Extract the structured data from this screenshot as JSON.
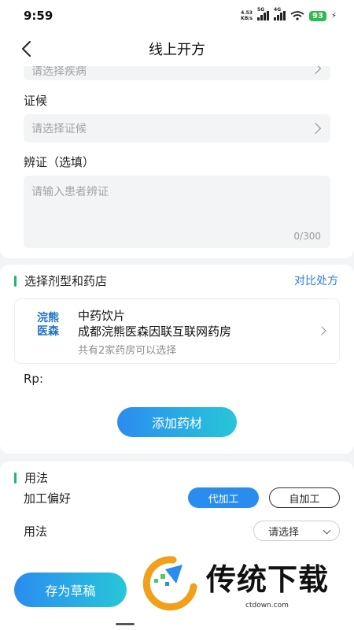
{
  "status": {
    "time": "9:59",
    "net_speed_value": "4.53",
    "net_speed_unit": "KB/s",
    "signal1_tag": "5G",
    "signal2_tag": "4G",
    "battery": "93"
  },
  "nav": {
    "title": "线上开方"
  },
  "top_form": {
    "disease_placeholder": "请选择疾病",
    "syndrome_label": "证候",
    "syndrome_placeholder": "请选择证候",
    "differentiation_label": "辨证（选填）",
    "differentiation_placeholder": "请输入患者辨证",
    "char_count": "0/300"
  },
  "dosage": {
    "title": "选择剂型和药店",
    "compare_link": "对比处方",
    "logo_line1": "浣熊",
    "logo_line2": "医森",
    "type": "中药饮片",
    "pharmacy_name": "成都浣熊医森因联互联网药房",
    "pharmacy_count": "共有2家药房可以选择",
    "rp_label": "Rp:",
    "add_button": "添加药材"
  },
  "usage": {
    "title": "用法",
    "processing_label": "加工偏好",
    "option_agent": "代加工",
    "option_self": "自加工",
    "usage_label": "用法",
    "usage_select": "请选择"
  },
  "footer": {
    "save_button": "存为草稿",
    "watermark_text": "传统下载",
    "watermark_url": "ctdown.com"
  }
}
